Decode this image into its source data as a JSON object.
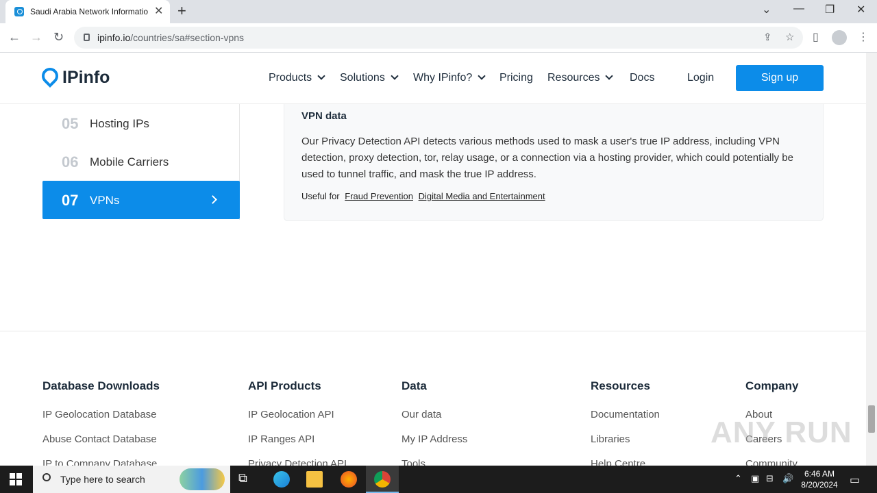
{
  "browser": {
    "tab_title": "Saudi Arabia Network Informatio",
    "url_host": "ipinfo.io",
    "url_path": "/countries/sa#section-vpns"
  },
  "site": {
    "logo_text": "IPinfo",
    "nav": [
      {
        "label": "Products"
      },
      {
        "label": "Solutions"
      },
      {
        "label": "Why IPinfo?"
      },
      {
        "label": "Pricing"
      },
      {
        "label": "Resources"
      },
      {
        "label": "Docs"
      }
    ],
    "login": "Login",
    "signup": "Sign up"
  },
  "sidebar": {
    "items": [
      {
        "num": "05",
        "label": "Hosting IPs"
      },
      {
        "num": "06",
        "label": "Mobile Carriers"
      },
      {
        "num": "07",
        "label": "VPNs"
      }
    ]
  },
  "vpn": {
    "title": "VPN data",
    "body": "Our Privacy Detection API detects various methods used to mask a user's true IP address, including VPN detection, proxy detection, tor, relay usage, or a connection via a hosting provider, which could potentially be used to tunnel traffic, and mask the true IP address.",
    "useful_for": "Useful for",
    "links": [
      "Fraud Prevention",
      "Digital Media and Entertainment"
    ]
  },
  "footer": {
    "cols": [
      {
        "title": "Database Downloads",
        "links": [
          "IP Geolocation Database",
          "Abuse Contact Database",
          "IP to Company Database"
        ]
      },
      {
        "title": "API Products",
        "links": [
          "IP Geolocation API",
          "IP Ranges API",
          "Privacy Detection API"
        ]
      },
      {
        "title": "Data",
        "links": [
          "Our data",
          "My IP Address",
          "Tools"
        ]
      },
      {
        "title": "Resources",
        "links": [
          "Documentation",
          "Libraries",
          "Help Centre"
        ]
      },
      {
        "title": "Company",
        "links": [
          "About",
          "Careers",
          "Community"
        ]
      }
    ]
  },
  "watermark": "ANY RUN",
  "taskbar": {
    "search_placeholder": "Type here to search",
    "time": "6:46 AM",
    "date": "8/20/2024"
  }
}
